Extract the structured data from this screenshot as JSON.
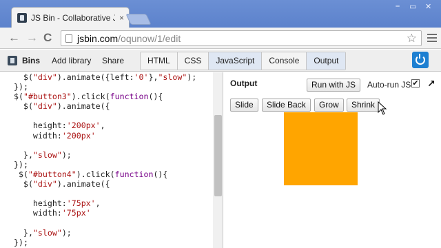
{
  "browser": {
    "tab_title": "JS Bin - Collaborative Java",
    "tab_close": "×",
    "url_host": "jsbin.com",
    "url_path": "/oqunow/1/edit",
    "back_glyph": "←",
    "forward_glyph": "→",
    "reload_glyph": "C",
    "star_glyph": "☆",
    "win_minimize": "–",
    "win_maximize": "▭",
    "win_close": "✕"
  },
  "jsbin": {
    "bins_label": "Bins",
    "add_library_label": "Add library",
    "share_label": "Share",
    "panel_tabs": [
      {
        "label": "HTML",
        "active": false
      },
      {
        "label": "CSS",
        "active": false
      },
      {
        "label": "JavaScript",
        "active": true
      },
      {
        "label": "Console",
        "active": false
      },
      {
        "label": "Output",
        "active": true
      }
    ]
  },
  "editor": {
    "lines": [
      "  $(\"div\").animate({left:'0'},\"slow\");",
      "});",
      "$(\"#button3\").click(function(){",
      "  $(\"div\").animate({",
      "",
      "    height:'200px',",
      "    width:'200px'",
      "",
      "  },\"slow\");",
      "});",
      " $(\"#button4\").click(function(){",
      "  $(\"div\").animate({",
      "",
      "    height:'75px',",
      "    width:'75px'",
      "",
      "  },\"slow\");",
      "});"
    ]
  },
  "output": {
    "label": "Output",
    "run_button": "Run with JS",
    "autorun_label": "Auto-run JS",
    "autorun_checked": "✔",
    "popout_glyph": "↗",
    "buttons": [
      "Slide",
      "Slide Back",
      "Grow",
      "Shrink"
    ],
    "box_color": "#ffa500"
  },
  "colors": {
    "accent": "#1d7fd1",
    "string": "#aa1111",
    "keyword": "#770088"
  }
}
